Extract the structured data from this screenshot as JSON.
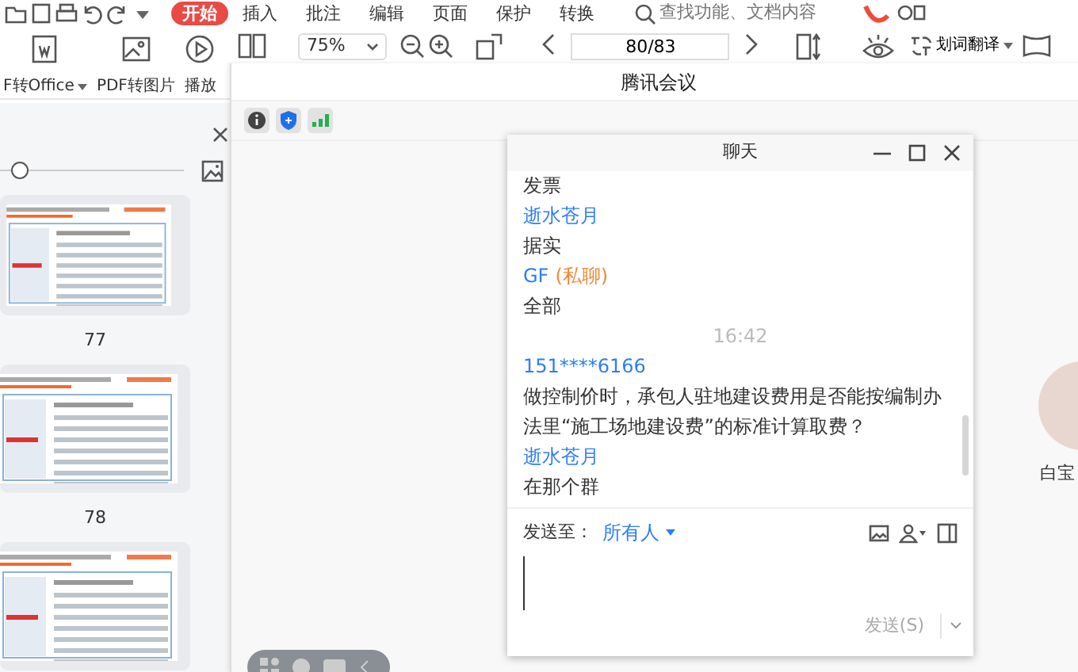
{
  "menu": {
    "tabs": [
      {
        "label": "开始",
        "selected": true
      },
      {
        "label": "插入",
        "selected": false
      },
      {
        "label": "批注",
        "selected": false
      },
      {
        "label": "编辑",
        "selected": false
      },
      {
        "label": "页面",
        "selected": false
      },
      {
        "label": "保护",
        "selected": false
      },
      {
        "label": "转换",
        "selected": false
      }
    ],
    "search": {
      "placeholder": "查找功能、文档内容"
    }
  },
  "toolbar": {
    "tools": [
      {
        "label": "F转Office",
        "dropdown": true
      },
      {
        "label": "PDF转图片",
        "dropdown": false
      },
      {
        "label": "播放",
        "dropdown": false
      }
    ],
    "zoom": "75%",
    "page": "80/83",
    "translate": "划词翻译"
  },
  "thumbnails": [
    {
      "kind": "page",
      "page": "77"
    },
    {
      "kind": "page",
      "page": "78"
    },
    {
      "kind": "page"
    }
  ],
  "meeting": {
    "title": "腾讯会议",
    "participants": [
      {
        "name": "白宝"
      }
    ]
  },
  "chat": {
    "title": "聊天",
    "messages": [
      {
        "kind": "text",
        "text": "发票"
      },
      {
        "kind": "sender",
        "text": "逝水苍月"
      },
      {
        "kind": "text",
        "text": "据实"
      },
      {
        "kind": "sender",
        "text": "GF",
        "private": "(私聊)"
      },
      {
        "kind": "text",
        "text": "全部"
      },
      {
        "kind": "time",
        "text": "16:42"
      },
      {
        "kind": "sender",
        "text": "151****6166"
      },
      {
        "kind": "text",
        "text": "做控制价时，承包人驻地建设费用是否能按编制办法里“施工场地建设费”的标准计算取费？"
      },
      {
        "kind": "sender",
        "text": "逝水苍月"
      },
      {
        "kind": "text",
        "text": "在那个群"
      }
    ],
    "send_to": "发送至：",
    "recipient": "所有人",
    "send": {
      "label": "发送(S)",
      "disabled": true
    }
  }
}
